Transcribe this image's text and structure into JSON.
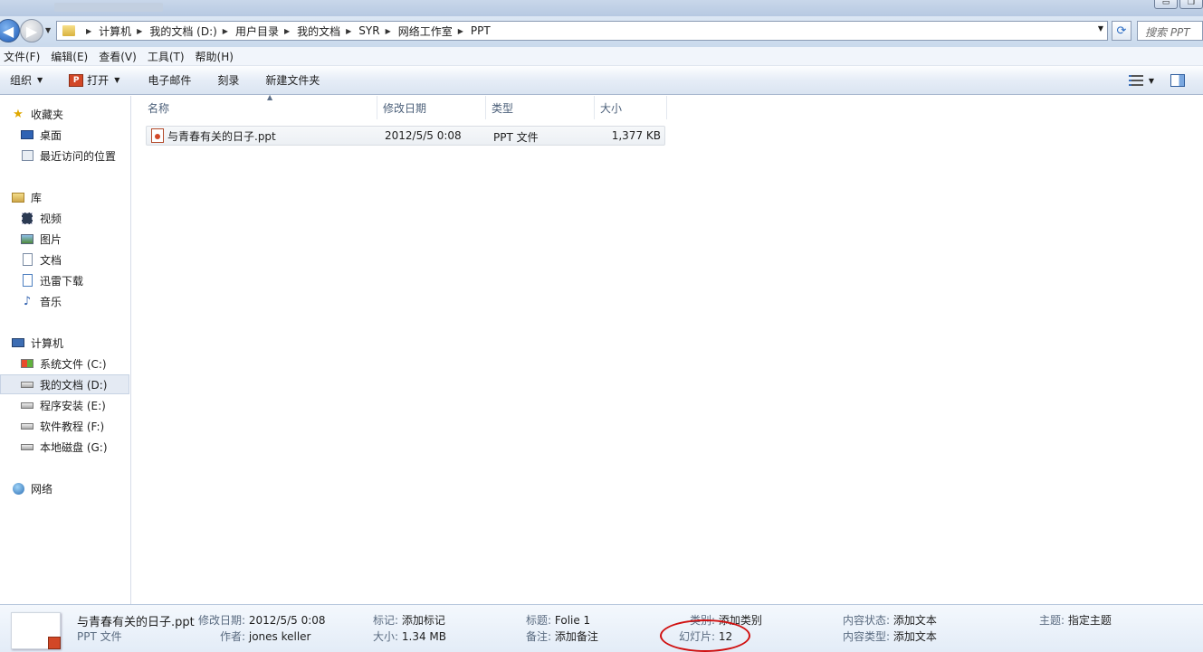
{
  "address": {
    "crumbs": [
      "计算机",
      "我的文档 (D:)",
      "用户目录",
      "我的文档",
      "SYR",
      "网络工作室",
      "PPT"
    ],
    "search_placeholder": "搜索 PPT"
  },
  "menu": [
    "文件(F)",
    "编辑(E)",
    "查看(V)",
    "工具(T)",
    "帮助(H)"
  ],
  "toolbar": {
    "organize": "组织",
    "open": "打开",
    "email": "电子邮件",
    "burn": "刻录",
    "new_folder": "新建文件夹"
  },
  "sidebar": {
    "favorites": "收藏夹",
    "desktop": "桌面",
    "recent": "最近访问的位置",
    "libraries": "库",
    "videos": "视频",
    "pictures": "图片",
    "documents": "文档",
    "xunlei": "迅雷下载",
    "music": "音乐",
    "computer": "计算机",
    "drive_c": "系统文件 (C:)",
    "drive_d": "我的文档 (D:)",
    "drive_e": "程序安装 (E:)",
    "drive_f": "软件教程 (F:)",
    "drive_g": "本地磁盘 (G:)",
    "network": "网络"
  },
  "columns": {
    "name": "名称",
    "modified": "修改日期",
    "type": "类型",
    "size": "大小"
  },
  "file": {
    "name": "与青春有关的日子.ppt",
    "modified": "2012/5/5 0:08",
    "type": "PPT 文件",
    "size": "1,377 KB"
  },
  "details": {
    "filename": "与青春有关的日子.ppt",
    "filetype": "PPT 文件",
    "modified_label": "修改日期:",
    "modified_value": "2012/5/5 0:08",
    "author_label": "作者:",
    "author_value": "jones keller",
    "tags_label": "标记:",
    "tags_value": "添加标记",
    "size_label": "大小:",
    "size_value": "1.34 MB",
    "title_label": "标题:",
    "title_value": "Folie 1",
    "comments_label": "备注:",
    "comments_value": "添加备注",
    "category_label": "类别:",
    "category_value": "添加类别",
    "slides_label": "幻灯片:",
    "slides_value": "12",
    "content_status_label": "内容状态:",
    "content_status_value": "添加文本",
    "content_type_label": "内容类型:",
    "content_type_value": "添加文本",
    "subject_label": "主题:",
    "subject_value": "指定主题"
  },
  "colors": {
    "annotation_oval": "#d01010",
    "accent": "#3a6db5"
  }
}
